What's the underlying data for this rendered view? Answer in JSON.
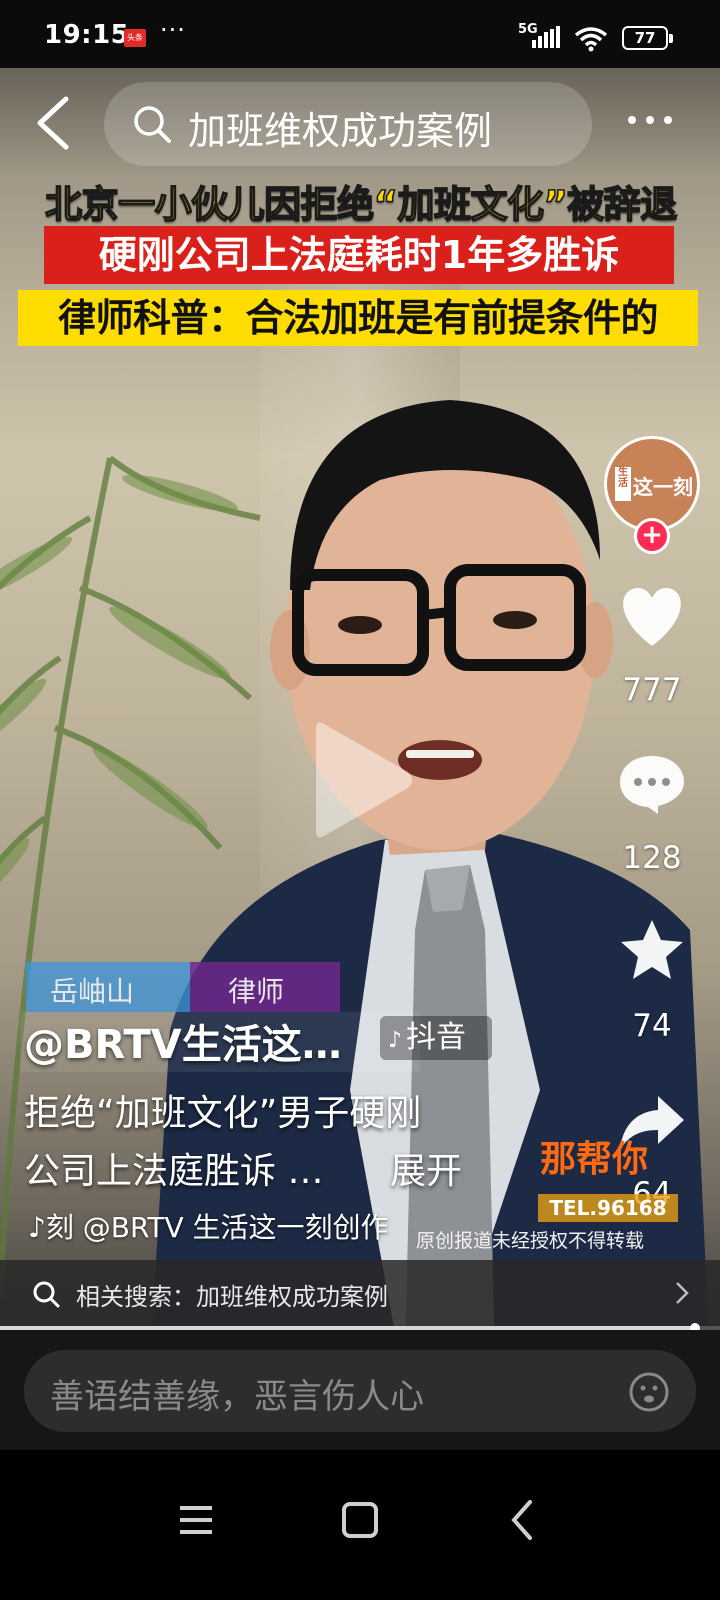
{
  "status_bar": {
    "time": "19:15",
    "app_badge": "头条",
    "dots": "···",
    "network": "5G",
    "battery": "77"
  },
  "search": {
    "query": "加班维权成功案例"
  },
  "video": {
    "headline_1": "北京一小伙儿因拒绝“加班文化”被辞退",
    "headline_2": "硬刚公司上法庭耗时1年多胜诉",
    "headline_3": "律师科普：合法加班是有前提条件的",
    "nameplate_name": "岳岫山",
    "nameplate_role": "律师",
    "tv_logo": "那帮你",
    "tv_tel": "TEL.96168",
    "copyright": "原创报道未经授权不得转载"
  },
  "rail": {
    "avatar_small": "生活",
    "avatar_text": "这一刻",
    "follow": "+",
    "likes": "777",
    "comments": "128",
    "favorites": "74",
    "shares": "64"
  },
  "post": {
    "author": "@BRTV生活这…",
    "source_badge": "抖音",
    "caption_line1": "拒绝“加班文化”男子硬刚",
    "caption_line2": "公司上法庭胜诉 …",
    "expand_label": "展开",
    "music": "刻   @BRTV 生活这一刻创作"
  },
  "related": {
    "label": "相关搜索：加班维权成功案例",
    "progress": 0.965
  },
  "comment": {
    "placeholder": "善语结善缘，恶言伤人心"
  },
  "colors": {
    "accent_pink": "#fe2c55",
    "headline_yellow": "#ffd900",
    "headline_red": "#d9201a"
  }
}
